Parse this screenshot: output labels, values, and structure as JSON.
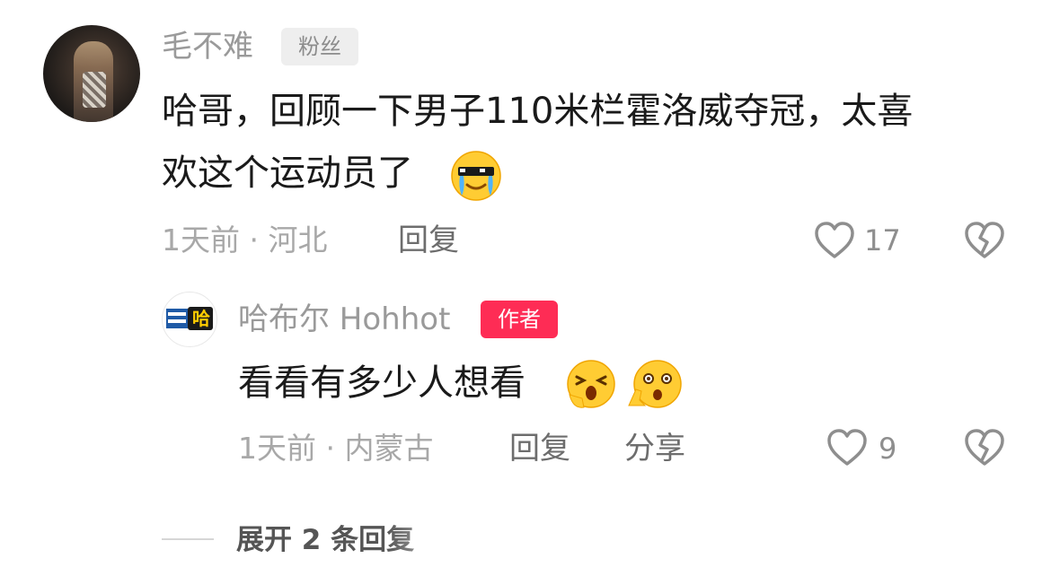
{
  "comment": {
    "username": "毛不难",
    "badge": "粉丝",
    "text_line1": "哈哥，回顾一下男子110米栏霍洛威夺冠，太喜",
    "text_line2": "欢这个运动员了",
    "emoji": "cool-crying-emoji",
    "time_location": "1天前 · 河北",
    "reply_label": "回复",
    "like_count": "17",
    "icons": {
      "like": "heart-outline-icon",
      "dislike": "broken-heart-icon"
    }
  },
  "reply": {
    "username": "哈布尔 Hohhot",
    "badge": "作者",
    "avatar_logo_text": "哈",
    "text": "看看有多少人想看",
    "emojis": [
      "laughing-emoji",
      "shocked-hand-emoji"
    ],
    "time_location": "1天前 · 内蒙古",
    "reply_label": "回复",
    "share_label": "分享",
    "like_count": "9",
    "icons": {
      "like": "heart-outline-icon",
      "dislike": "broken-heart-icon"
    }
  },
  "expand": {
    "label": "展开 2 条回复"
  },
  "colors": {
    "author_badge": "#fe2c55",
    "fan_badge_bg": "#eeeeee",
    "meta_text": "#a8a8a8"
  }
}
